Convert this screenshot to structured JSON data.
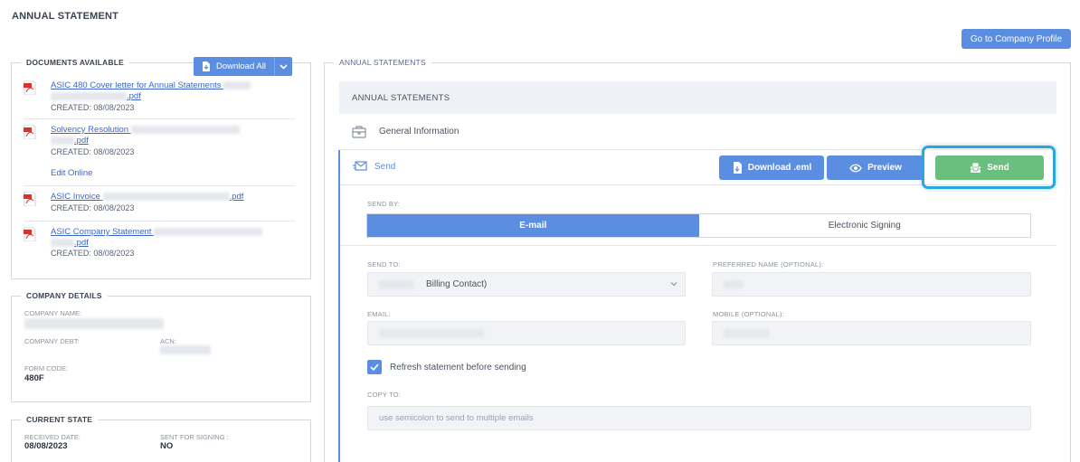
{
  "page": {
    "title": "ANNUAL STATEMENT"
  },
  "header": {
    "company_profile_button": "Go to Company Profile"
  },
  "documents": {
    "legend": "DOCUMENTS AVAILABLE",
    "download_all_label": "Download All",
    "items": [
      {
        "link_text": "ASIC 480 Cover letter for Annual Statements",
        "link_suffix": ".pdf",
        "created": "CREATED: 08/08/2023"
      },
      {
        "link_text": "Solvency Resolution",
        "link_suffix": ".pdf",
        "created": "CREATED: 08/08/2023",
        "extra_link": "Edit Online"
      },
      {
        "link_text": "ASIC Invoice",
        "link_suffix": ".pdf",
        "created": "CREATED: 08/08/2023"
      },
      {
        "link_text": "ASIC Company Statement",
        "link_suffix": ".pdf",
        "created": "CREATED: 08/08/2023"
      }
    ]
  },
  "company_details": {
    "legend": "COMPANY DETAILS",
    "company_name_label": "COMPANY NAME:",
    "company_debt_label": "COMPANY DEBT:",
    "acn_label": "ACN:",
    "form_code_label": "FORM CODE:",
    "form_code_value": "480F"
  },
  "current_state": {
    "legend": "CURRENT STATE",
    "received_date_label": "RECEIVED DATE:",
    "received_date_value": "08/08/2023",
    "sent_for_signing_label": "SENT FOR SIGNING :",
    "sent_for_signing_value": "NO"
  },
  "annual_statements": {
    "legend": "ANNUAL STATEMENTS",
    "header": "ANNUAL STATEMENTS",
    "general_information": "General Information",
    "send_section": {
      "title": "Send",
      "download_eml_button": "Download .eml",
      "preview_button": "Preview",
      "send_button": "Send",
      "send_by_label": "SEND BY:",
      "send_by_options": [
        "E-mail",
        "Electronic Signing"
      ],
      "send_by_selected": "E-mail",
      "send_to_label": "SEND TO:",
      "send_to_value": "Billing Contact)",
      "preferred_name_label": "PREFERRED NAME (OPTIONAL):",
      "email_label": "EMAIL:",
      "mobile_label": "MOBILE (OPTIONAL):",
      "refresh_checkbox_label": "Refresh statement before sending",
      "refresh_checked": true,
      "copy_to_label": "COPY TO:",
      "copy_to_placeholder": "use semicolon to send to multiple emails"
    }
  },
  "colors": {
    "primary": "#5b8ee0",
    "success": "#6abf7e",
    "highlight": "#2aa5dd",
    "link": "#3c67c9"
  }
}
